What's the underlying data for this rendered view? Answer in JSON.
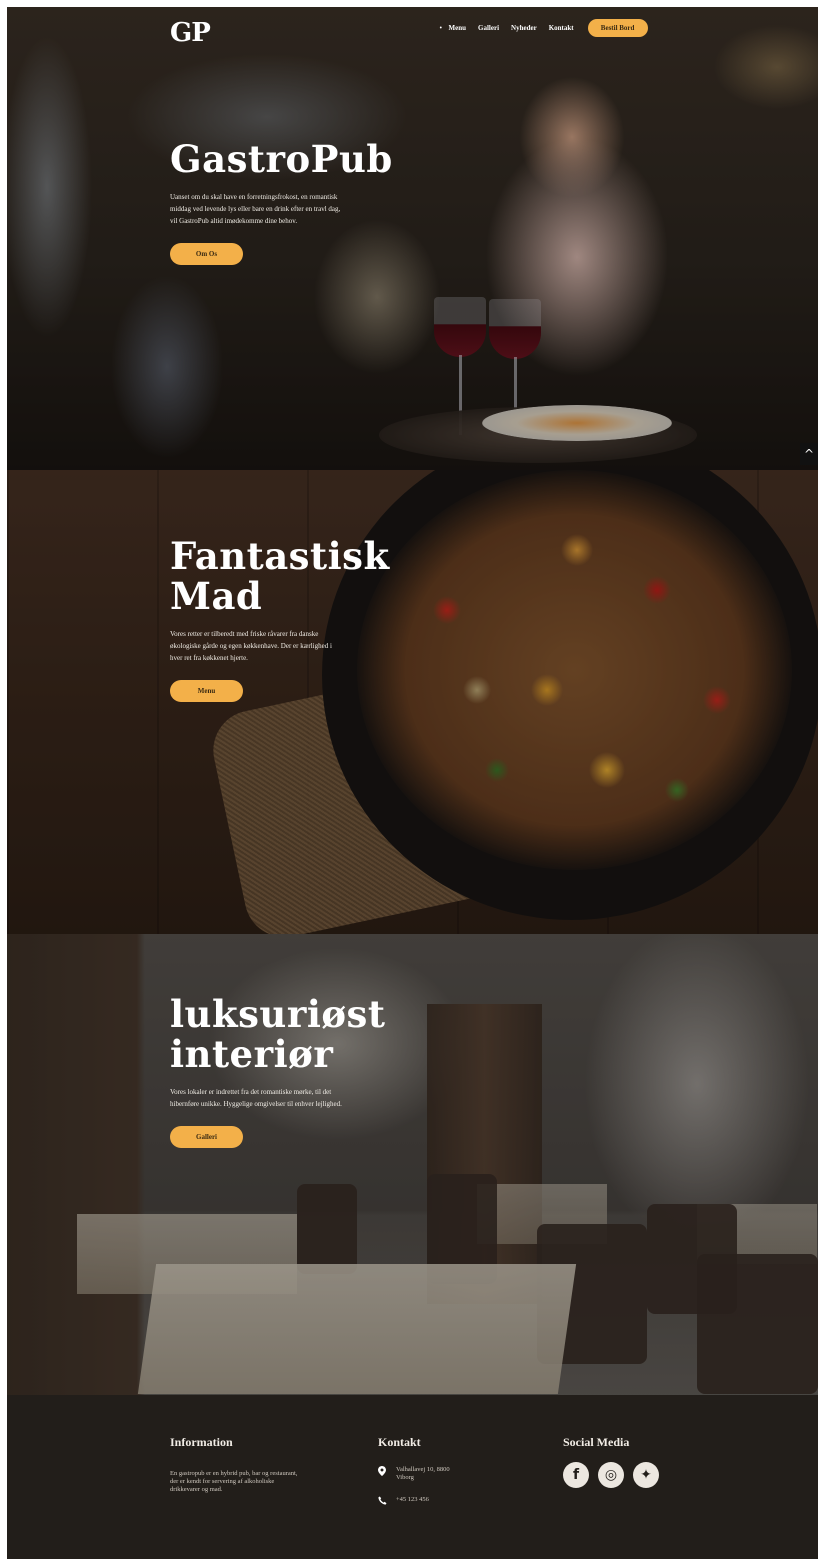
{
  "nav": {
    "logo": "GP",
    "dot": "•",
    "links": [
      "Menu",
      "Galleri",
      "Nyheder",
      "Kontakt"
    ],
    "cta": "Bestil Bord"
  },
  "hero1": {
    "title": "GastroPub",
    "text": "Uanset om du skal have en forretningsfrokost, en romantisk middag ved levende lys eller bare en drink efter en travl dag, vil GastroPub altid imødekomme dine behov.",
    "button": "Om Os"
  },
  "hero2": {
    "title": "Fantastisk Mad",
    "text": "Vores retter er tilberedt med friske råvarer fra danske økologiske gårde og egen køkkenhave. Der er kærlighed i hver ret fra køkkenet hjerte.",
    "button": "Menu"
  },
  "hero3": {
    "title": "luksuriøst interiør",
    "text": "Vores lokaler er indrettet fra det romantiske mørke, til det hibernføre unikke. Hyggelige omgivelser til enhver lejlighed.",
    "button": "Galleri"
  },
  "scroll_top": "^",
  "footer": {
    "info": {
      "heading": "Information",
      "text": "En gastropub er en hybrid pub, bar og restaurant, der er kendt for servering af alkoholiske drikkevarer og mad."
    },
    "contact": {
      "heading": "Kontakt",
      "address": "Valhallavej 10, 8800 Viborg",
      "phone": "+45 123 456",
      "address_icon": "location-pin-icon",
      "phone_icon": "phone-icon"
    },
    "social": {
      "heading": "Social Media",
      "icons": [
        {
          "name": "facebook-icon",
          "glyph": "f"
        },
        {
          "name": "instagram-icon",
          "glyph": "◎"
        },
        {
          "name": "twitter-icon",
          "glyph": "✦"
        }
      ]
    }
  },
  "colors": {
    "accent": "#f3b049",
    "footer_bg": "#221e1a"
  }
}
